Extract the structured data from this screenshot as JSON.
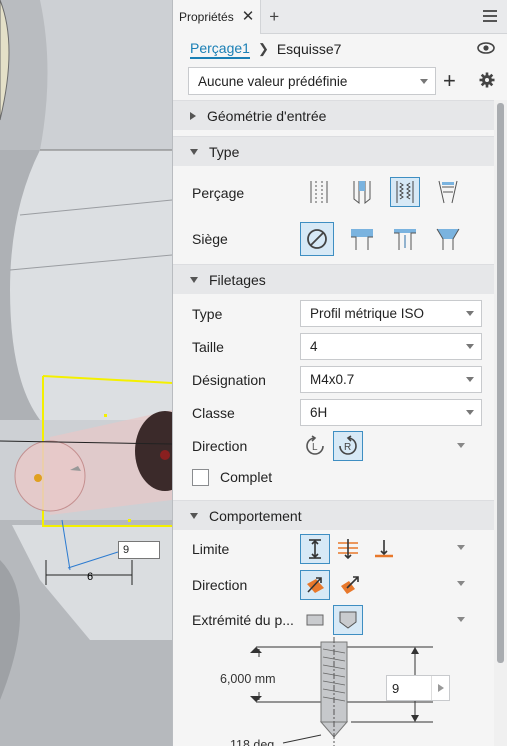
{
  "panel": {
    "tab_title": "Propriétés",
    "breadcrumb": {
      "feature": "Perçage1",
      "sketch": "Esquisse7"
    },
    "preset": "Aucune valeur prédéfinie"
  },
  "sections": {
    "input_geometry": "Géométrie d'entrée",
    "type": "Type",
    "threads": "Filetages",
    "behavior": "Comportement"
  },
  "type_section": {
    "hole_label": "Perçage",
    "seat_label": "Siège",
    "hole_icons": [
      "simple-hole-icon",
      "clearance-hole-icon",
      "tapped-hole-icon",
      "taper-tapped-hole-icon"
    ],
    "hole_selected": "tapped-hole-icon",
    "seat_icons": [
      "no-seat-icon",
      "counterbore-icon",
      "spotface-icon",
      "countersink-icon"
    ],
    "seat_selected": "no-seat-icon"
  },
  "threads": {
    "type_label": "Type",
    "type_value": "Profil métrique ISO",
    "size_label": "Taille",
    "size_value": "4",
    "designation_label": "Désignation",
    "designation_value": "M4x0.7",
    "class_label": "Classe",
    "class_value": "6H",
    "direction_label": "Direction",
    "full_label": "Complet"
  },
  "behavior": {
    "limit_label": "Limite",
    "direction_label": "Direction",
    "end_label": "Extrémité du p...",
    "depth_dim": "6,000 mm",
    "angle_dim": "118 deg",
    "hole_depth_value": "9"
  },
  "viewport": {
    "dim_value": "9",
    "dim_label": "6"
  },
  "colors": {
    "accent": "#1a7fb5",
    "selected_bg": "#d7e9f6",
    "orange": "#e8782b",
    "sketch_yellow": "#f4f000"
  }
}
